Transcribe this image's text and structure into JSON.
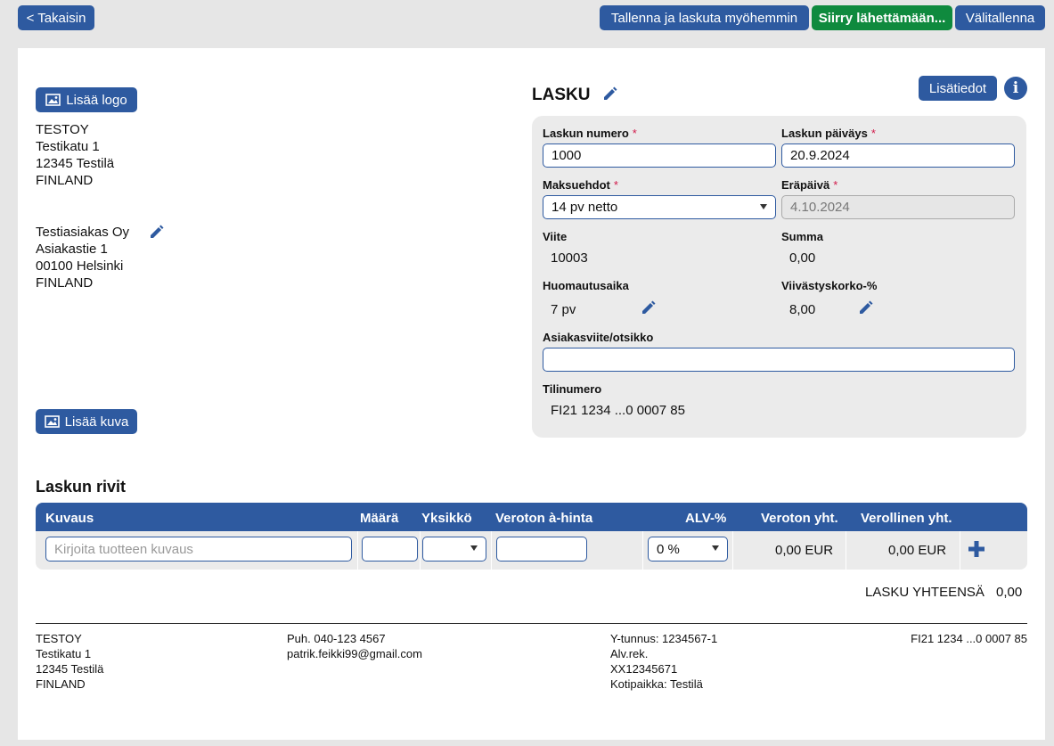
{
  "toolbar": {
    "back_label": "< Takaisin",
    "save_invoice_later_label": "Tallenna ja laskuta myöhemmin",
    "go_send_label": "Siirry lähettämään...",
    "draft_save_label": "Välitallenna"
  },
  "sender": {
    "add_logo_label": "Lisää logo",
    "name": "TESTOY",
    "street": "Testikatu 1",
    "postal": "12345 Testilä",
    "country": "FINLAND"
  },
  "customer": {
    "name": "Testiasiakas Oy",
    "street": "Asiakastie 1",
    "postal": "00100 Helsinki",
    "country": "FINLAND"
  },
  "add_image_label": "Lisää kuva",
  "invoice": {
    "title": "LASKU",
    "extra_info_label": "Lisätiedot",
    "fields": {
      "number_label": "Laskun numero",
      "number_value": "1000",
      "date_label": "Laskun päiväys",
      "date_value": "20.9.2024",
      "terms_label": "Maksuehdot",
      "terms_value": "14 pv netto",
      "due_label": "Eräpäivä",
      "due_value": "4.10.2024",
      "ref_label": "Viite",
      "ref_value": "10003",
      "sum_label": "Summa",
      "sum_value": "0,00",
      "notice_label": "Huomautusaika",
      "notice_value": "7 pv",
      "interest_label": "Viivästyskorko-%",
      "interest_value": "8,00",
      "customer_ref_label": "Asiakasviite/otsikko",
      "customer_ref_value": "",
      "account_label": "Tilinumero",
      "account_value": "FI21 1234 ...0 0007 85",
      "required_mark": "*"
    }
  },
  "rows": {
    "title": "Laskun rivit",
    "headers": [
      "Kuvaus",
      "Määrä",
      "Yksikkö",
      "Veroton à-hinta",
      "ALV-%",
      "Veroton yht.",
      "Verollinen yht."
    ],
    "description_placeholder": "Kirjoita tuotteen kuvaus",
    "vat_value": "0 %",
    "net_total": "0,00 EUR",
    "gross_total": "0,00 EUR"
  },
  "total": {
    "label": "LASKU YHTEENSÄ",
    "value": "0,00"
  },
  "footer": {
    "col1": [
      "TESTOY",
      "Testikatu 1",
      "12345 Testilä",
      "FINLAND"
    ],
    "col2": [
      "Puh. 040-123 4567",
      "patrik.feikki99@gmail.com"
    ],
    "col3": [
      "Y-tunnus: 1234567-1",
      "Alv.rek.",
      "XX12345671",
      "Kotipaikka: Testilä"
    ],
    "col4": [
      "FI21 1234 ...0 0007 85"
    ]
  },
  "colors": {
    "primary": "#2e5aa0",
    "success": "#0f8a3e",
    "required": "#d11a4a"
  }
}
